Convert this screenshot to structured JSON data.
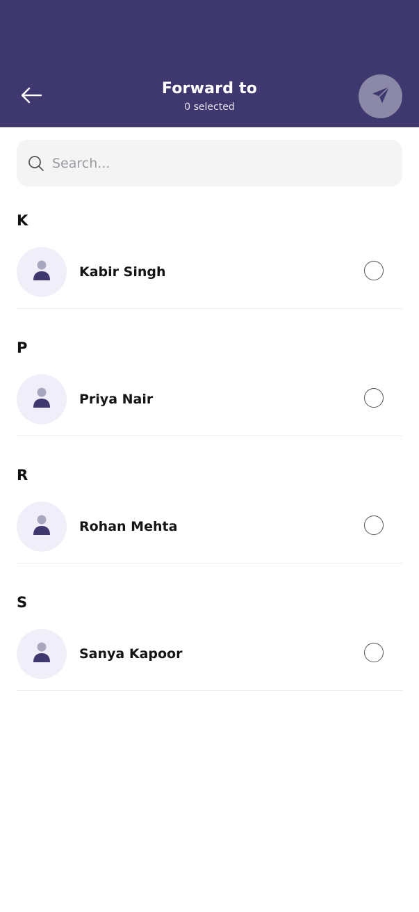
{
  "header": {
    "title": "Forward to",
    "subtitle": "0 selected",
    "back_icon": "arrow-left-icon",
    "send_icon": "send-icon",
    "background_color": "#3e386e"
  },
  "search": {
    "placeholder": "Search...",
    "value": "",
    "icon": "search-icon"
  },
  "sections": [
    {
      "letter": "K",
      "contacts": [
        {
          "name": "Kabir Singh",
          "selected": false
        }
      ]
    },
    {
      "letter": "P",
      "contacts": [
        {
          "name": "Priya Nair",
          "selected": false
        }
      ]
    },
    {
      "letter": "R",
      "contacts": [
        {
          "name": "Rohan Mehta",
          "selected": false
        }
      ]
    },
    {
      "letter": "S",
      "contacts": [
        {
          "name": "Sanya Kapoor",
          "selected": false
        }
      ]
    }
  ]
}
